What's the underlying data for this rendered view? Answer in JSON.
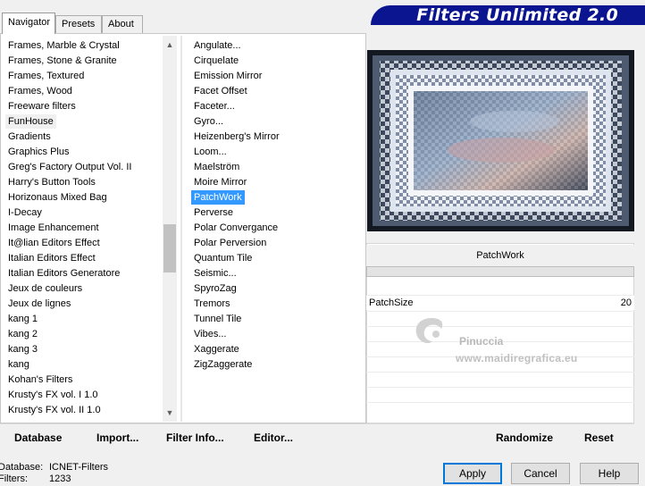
{
  "tabs": [
    {
      "label": "Navigator",
      "active": true
    },
    {
      "label": "Presets",
      "active": false
    },
    {
      "label": "About",
      "active": false
    }
  ],
  "banner": {
    "title": "Filters Unlimited 2.0",
    "color": "#0b1590"
  },
  "categories": {
    "items": [
      "Frames, Marble & Crystal",
      "Frames, Stone & Granite",
      "Frames, Textured",
      "Frames, Wood",
      "Freeware filters",
      "FunHouse",
      "Gradients",
      "Graphics Plus",
      "Greg's Factory Output Vol. II",
      "Harry's Button Tools",
      "Horizonaus Mixed Bag",
      "I-Decay",
      "Image Enhancement",
      "It@lian Editors Effect",
      "Italian Editors Effect",
      "Italian Editors Generatore",
      "Jeux de couleurs",
      "Jeux de lignes",
      "kang 1",
      "kang 2",
      "kang 3",
      "kang",
      "Kohan's Filters",
      "Krusty's FX vol. I 1.0",
      "Krusty's FX vol. II 1.0"
    ],
    "selected": "FunHouse"
  },
  "filters": {
    "items": [
      "Angulate...",
      "Cirquelate",
      "Emission Mirror",
      "Facet Offset",
      "Faceter...",
      "Gyro...",
      "Heizenberg's Mirror",
      "Loom...",
      "Maelström",
      "Moire Mirror",
      "PatchWork",
      "Perverse",
      "Polar Convergance",
      "Polar Perversion",
      "Quantum Tile",
      "Seismic...",
      "SpyroZag",
      "Tremors",
      "Tunnel Tile",
      "Vibes...",
      "Xaggerate",
      "ZigZaggerate"
    ],
    "selected": "PatchWork"
  },
  "preview": {
    "filter_name": "PatchWork"
  },
  "parameters": [
    {
      "label": "PatchSize",
      "value": "20"
    }
  ],
  "watermark": {
    "name": "Pinuccia",
    "url": "www.maidiregrafica.eu"
  },
  "toolbar": {
    "database": "Database",
    "import": "Import...",
    "filter_info": "Filter Info...",
    "editor": "Editor...",
    "randomize": "Randomize",
    "reset": "Reset"
  },
  "status": {
    "database_label": "Database:",
    "database_value": "ICNET-Filters",
    "filters_label": "Filters:",
    "filters_value": "1233"
  },
  "buttons": {
    "apply": "Apply",
    "cancel": "Cancel",
    "help": "Help"
  },
  "colors": {
    "selection": "#3399ff",
    "banner": "#0b1590"
  },
  "icons": {
    "scroll_up": "chevron-up-icon",
    "scroll_down": "chevron-down-icon"
  }
}
